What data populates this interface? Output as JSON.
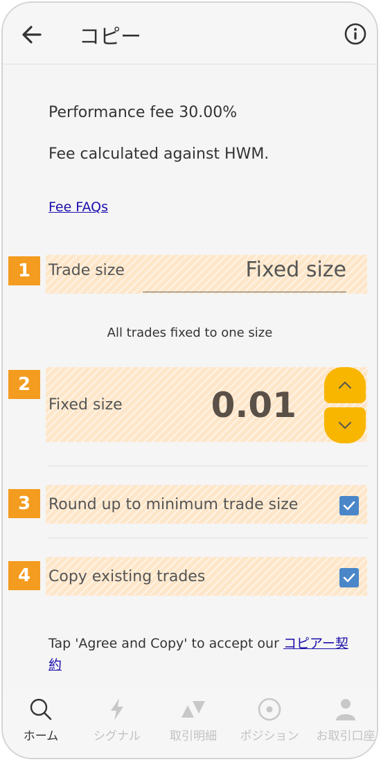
{
  "header": {
    "title": "コピー",
    "back_icon": "arrow-left-icon",
    "info_icon": "info-circle-icon"
  },
  "fees": {
    "performance": "Performance fee 30.00%",
    "hwm": "Fee calculated against HWM.",
    "faq_link": "Fee FAQs"
  },
  "trade_size": {
    "badge": "1",
    "label": "Trade size",
    "value": "Fixed size",
    "caption": "All trades fixed to one size"
  },
  "fixed_size": {
    "badge": "2",
    "label": "Fixed size",
    "value": "0.01"
  },
  "round_up": {
    "badge": "3",
    "label": "Round up to minimum trade size",
    "checked": true
  },
  "copy_existing": {
    "badge": "4",
    "label": "Copy existing trades",
    "checked": true
  },
  "agreement": {
    "text": "Tap 'Agree and Copy' to accept our ",
    "link_line1": "コピアー契",
    "link_line2": "約"
  },
  "nav": [
    {
      "label": "ホーム",
      "icon": "search-icon",
      "active": true
    },
    {
      "label": "シグナル",
      "icon": "lightning-icon",
      "active": false
    },
    {
      "label": "取引明細",
      "icon": "triangles-icon",
      "active": false
    },
    {
      "label": "ポジション",
      "icon": "target-icon",
      "active": false
    },
    {
      "label": "お取引口座",
      "icon": "person-icon",
      "active": false
    }
  ],
  "colors": {
    "accent": "#f8b600",
    "badge": "#f39c1f",
    "checkbox": "#4a86c8",
    "link": "#1a0dab"
  }
}
